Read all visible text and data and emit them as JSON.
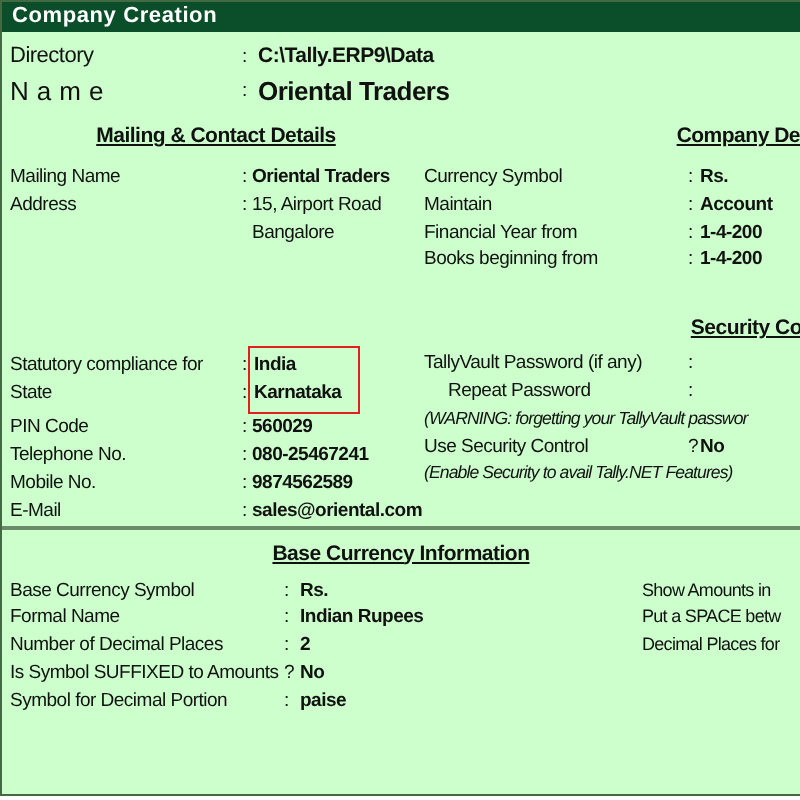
{
  "window": {
    "title": "Company Creation"
  },
  "header_fields": [
    {
      "label": "Directory",
      "sep": ":",
      "value": "C:\\Tally.ERP9\\Data",
      "kind": "directory"
    },
    {
      "label": "Name",
      "sep": ":",
      "value": "Oriental Traders",
      "kind": "name"
    }
  ],
  "mailing": {
    "heading": "Mailing & Contact Details",
    "fields": [
      {
        "label": "Mailing Name",
        "sep": ":",
        "lines": [
          "Oriental Traders"
        ],
        "bold": true
      },
      {
        "label": "Address",
        "sep": ":",
        "lines": [
          "15, Airport Road",
          "Bangalore"
        ],
        "bold": false
      }
    ],
    "statutory": {
      "highlighted": true,
      "fields": [
        {
          "label": "Statutory compliance for",
          "sep": ":",
          "value": "India"
        },
        {
          "label": "State",
          "sep": ":",
          "value": "Karnataka"
        }
      ]
    },
    "contact_fields": [
      {
        "label": "PIN Code",
        "sep": ":",
        "value": "560029"
      },
      {
        "label": "Telephone No.",
        "sep": ":",
        "value": "080-25467241"
      },
      {
        "label": "Mobile No.",
        "sep": ":",
        "value": "9874562589"
      },
      {
        "label": "E-Mail",
        "sep": ":",
        "value": "sales@oriental.com"
      }
    ]
  },
  "company_details": {
    "heading": "Company De",
    "fields": [
      {
        "label": "Currency Symbol",
        "sep": ":",
        "value": "Rs."
      },
      {
        "label": "Maintain",
        "sep": ":",
        "value": "Account"
      },
      {
        "label": "Financial Year from",
        "sep": ":",
        "value": "1-4-200"
      },
      {
        "label": "Books beginning from",
        "sep": ":",
        "value": "1-4-200"
      }
    ]
  },
  "security": {
    "heading": "Security Co",
    "rows": [
      {
        "kind": "field",
        "label": "TallyVault Password (if any)",
        "sep": ":",
        "indented": false
      },
      {
        "kind": "field",
        "label": "Repeat Password",
        "sep": ":",
        "indented": true
      },
      {
        "kind": "note",
        "text": "(WARNING: forgetting your TallyVault passwor"
      },
      {
        "kind": "field",
        "label": "Use Security Control",
        "sep": "?",
        "value": "No",
        "indented": false
      },
      {
        "kind": "note",
        "text": "(Enable Security to avail Tally.NET Features)"
      }
    ]
  },
  "base_currency": {
    "heading": "Base Currency Information",
    "fields": [
      {
        "label": "Base Currency Symbol",
        "sep": ":",
        "value": "Rs."
      },
      {
        "label": "Formal Name",
        "sep": ":",
        "value": "Indian Rupees"
      },
      {
        "label": "Number of Decimal Places",
        "sep": ":",
        "value": "2"
      },
      {
        "label": "Is Symbol SUFFIXED to Amounts",
        "sep": "?",
        "value": "No"
      },
      {
        "label": "Symbol for Decimal Portion",
        "sep": ":",
        "value": "paise"
      }
    ],
    "side_labels": [
      "Show Amounts in",
      "Put a SPACE betw",
      "Decimal Places for"
    ]
  }
}
